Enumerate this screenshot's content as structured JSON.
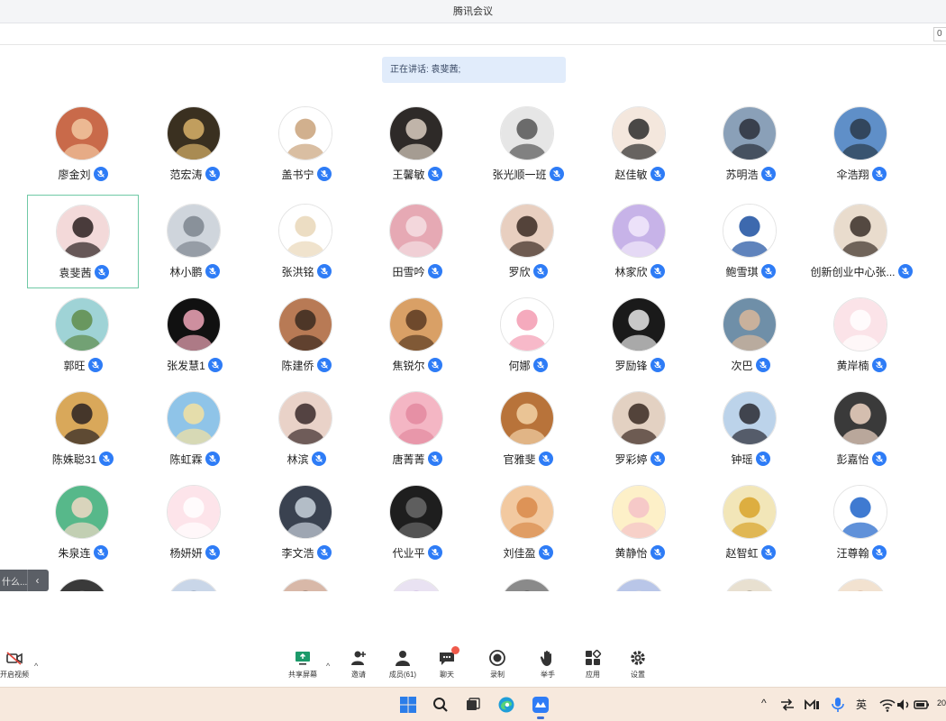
{
  "window": {
    "title": "腾讯会议",
    "edge_input_value": "0"
  },
  "speaking_banner": "正在讲话: 袁斐茜;",
  "participants": [
    {
      "name": "廖金刘",
      "avatar_colors": [
        "#c96a4a",
        "#f2c7a0"
      ],
      "active": false
    },
    {
      "name": "范宏涛",
      "avatar_colors": [
        "#3a3020",
        "#d9b26a"
      ],
      "active": false
    },
    {
      "name": "盖书宁",
      "avatar_colors": [
        "#ffffff",
        "#c9a27a"
      ],
      "active": false
    },
    {
      "name": "王馨敏",
      "avatar_colors": [
        "#2e2a28",
        "#d9cdbf"
      ],
      "active": false
    },
    {
      "name": "张光顺一班",
      "avatar_colors": [
        "#e6e6e6",
        "#555555"
      ],
      "active": false
    },
    {
      "name": "赵佳敏",
      "avatar_colors": [
        "#f4e7dd",
        "#2b2b2b"
      ],
      "active": false
    },
    {
      "name": "苏明浩",
      "avatar_colors": [
        "#8aa0b8",
        "#2a2f3a"
      ],
      "active": false
    },
    {
      "name": "伞浩翔",
      "avatar_colors": [
        "#5f8fc8",
        "#2a3a4a"
      ],
      "active": false
    },
    {
      "name": "袁斐茜",
      "avatar_colors": [
        "#f3d9d9",
        "#2a1f1f"
      ],
      "active": true
    },
    {
      "name": "林小鹏",
      "avatar_colors": [
        "#cfd5dc",
        "#7d858e"
      ],
      "active": false
    },
    {
      "name": "张洪铭",
      "avatar_colors": [
        "#ffffff",
        "#e9d7b8"
      ],
      "active": false
    },
    {
      "name": "田雪吟",
      "avatar_colors": [
        "#e6a9b4",
        "#f4dfe3"
      ],
      "active": false
    },
    {
      "name": "罗欣",
      "avatar_colors": [
        "#e8cfc0",
        "#3a2a22"
      ],
      "active": false
    },
    {
      "name": "林家欣",
      "avatar_colors": [
        "#c7b3e8",
        "#f2e9fb"
      ],
      "active": false
    },
    {
      "name": "鲍雪琪",
      "avatar_colors": [
        "#ffffff",
        "#1b4fa0"
      ],
      "active": false
    },
    {
      "name": "创新创业中心张...",
      "avatar_colors": [
        "#e9dccd",
        "#3a2f28"
      ],
      "active": false
    },
    {
      "name": "郭旺",
      "avatar_colors": [
        "#9fd3d6",
        "#5f8c4a"
      ],
      "active": false
    },
    {
      "name": "张发慧1",
      "avatar_colors": [
        "#111111",
        "#f0a6b8"
      ],
      "active": false
    },
    {
      "name": "陈建侨",
      "avatar_colors": [
        "#b87a55",
        "#3a2a20"
      ],
      "active": false
    },
    {
      "name": "焦锐尔",
      "avatar_colors": [
        "#d9a066",
        "#5a3a22"
      ],
      "active": false
    },
    {
      "name": "何娜",
      "avatar_colors": [
        "#ffffff",
        "#f39bb2"
      ],
      "active": false
    },
    {
      "name": "罗励锋",
      "avatar_colors": [
        "#1a1a1a",
        "#e7e7e7"
      ],
      "active": false
    },
    {
      "name": "次巴",
      "avatar_colors": [
        "#6f8fa8",
        "#d9b79a"
      ],
      "active": false
    },
    {
      "name": "黄岸楠",
      "avatar_colors": [
        "#fbe3e8",
        "#ffffff"
      ],
      "active": false
    },
    {
      "name": "陈姝聪31",
      "avatar_colors": [
        "#d9a85a",
        "#2a2222"
      ],
      "active": false
    },
    {
      "name": "陈虹霖",
      "avatar_colors": [
        "#8fc4e8",
        "#f5e2a0"
      ],
      "active": false
    },
    {
      "name": "林滨",
      "avatar_colors": [
        "#e9d2c8",
        "#3a2a2a"
      ],
      "active": false
    },
    {
      "name": "唐菁菁",
      "avatar_colors": [
        "#f4b6c4",
        "#e38aa0"
      ],
      "active": false
    },
    {
      "name": "官雅斐",
      "avatar_colors": [
        "#b8733a",
        "#f2d2a6"
      ],
      "active": false
    },
    {
      "name": "罗彩婷",
      "avatar_colors": [
        "#e3d1c2",
        "#3a2a22"
      ],
      "active": false
    },
    {
      "name": "钟瑶",
      "avatar_colors": [
        "#bcd3ea",
        "#2a2a33"
      ],
      "active": false
    },
    {
      "name": "彭嘉怡",
      "avatar_colors": [
        "#3a3a3a",
        "#f0d6c4"
      ],
      "active": false
    },
    {
      "name": "朱泉连",
      "avatar_colors": [
        "#57b88a",
        "#f0d8c4"
      ],
      "active": false
    },
    {
      "name": "杨妍妍",
      "avatar_colors": [
        "#fde4ea",
        "#ffffff"
      ],
      "active": false
    },
    {
      "name": "李文浩",
      "avatar_colors": [
        "#3a4250",
        "#c9d2dc"
      ],
      "active": false
    },
    {
      "name": "代业平",
      "avatar_colors": [
        "#1e1e1e",
        "#6a6a6a"
      ],
      "active": false
    },
    {
      "name": "刘佳盈",
      "avatar_colors": [
        "#f2c9a0",
        "#d98a4a"
      ],
      "active": false
    },
    {
      "name": "黄静怡",
      "avatar_colors": [
        "#fdf0c8",
        "#f4c2c8"
      ],
      "active": false
    },
    {
      "name": "赵智虹",
      "avatar_colors": [
        "#f2e6b8",
        "#d9a32a"
      ],
      "active": false
    },
    {
      "name": "汪尊翰",
      "avatar_colors": [
        "#ffffff",
        "#1d63c9"
      ],
      "active": false
    },
    {
      "name": "",
      "avatar_colors": [
        "#3a3a3a",
        "#9a9a9a"
      ],
      "active": false
    },
    {
      "name": "",
      "avatar_colors": [
        "#c9d6e8",
        "#5f6f88"
      ],
      "active": false
    },
    {
      "name": "",
      "avatar_colors": [
        "#d8b8a8",
        "#4a3a33"
      ],
      "active": false
    },
    {
      "name": "",
      "avatar_colors": [
        "#e9e2f2",
        "#b78ed2"
      ],
      "active": false
    },
    {
      "name": "",
      "avatar_colors": [
        "#8a8a8a",
        "#2a2a2a"
      ],
      "active": false
    },
    {
      "name": "",
      "avatar_colors": [
        "#b9c6e8",
        "#f2e2c8"
      ],
      "active": false
    },
    {
      "name": "",
      "avatar_colors": [
        "#e8e0d0",
        "#5a4a3a"
      ],
      "active": false
    },
    {
      "name": "",
      "avatar_colors": [
        "#f2e2d0",
        "#c48a6a"
      ],
      "active": false
    }
  ],
  "side_tab": {
    "text": "什么...",
    "chevron": "‹"
  },
  "toolbar": {
    "left": {
      "label": "开启视频",
      "icon": "camera-off-icon"
    },
    "items": [
      {
        "label": "共享屏幕",
        "icon": "share-screen-icon"
      },
      {
        "label": "邀请",
        "icon": "invite-icon"
      },
      {
        "label": "成员(61)",
        "icon": "members-icon"
      },
      {
        "label": "聊天",
        "icon": "chat-icon"
      },
      {
        "label": "录制",
        "icon": "record-icon"
      },
      {
        "label": "举手",
        "icon": "raise-hand-icon"
      },
      {
        "label": "应用",
        "icon": "apps-icon"
      },
      {
        "label": "设置",
        "icon": "settings-icon"
      }
    ],
    "caret": "^"
  },
  "taskbar": {
    "apps": [
      "windows-start-icon",
      "search-icon",
      "task-view-icon",
      "edge-browser-icon",
      "tencent-meeting-icon"
    ],
    "tray": {
      "chevron": "^",
      "ime": "英",
      "clock_fragment": "20"
    }
  },
  "colors": {
    "mic_blue": "#2e7cf6",
    "active_border": "#6fc9a5",
    "banner_bg": "#e1ecfb",
    "badge_red": "#ef5a4b"
  }
}
